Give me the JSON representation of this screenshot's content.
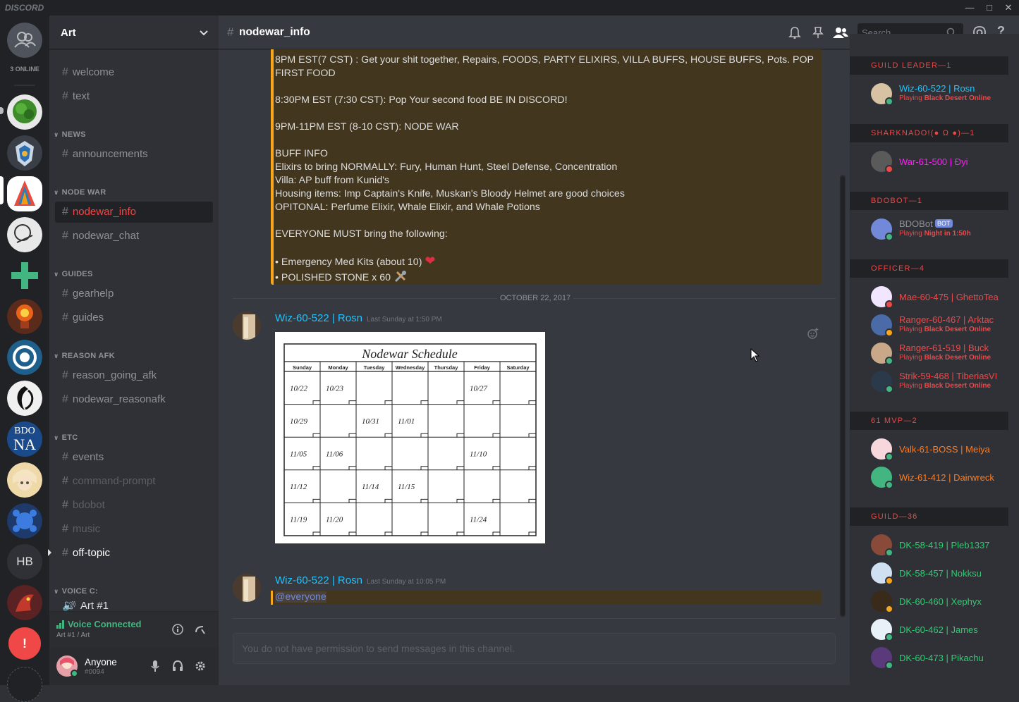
{
  "app": {
    "logo": "DISCORD",
    "win_min": "—",
    "win_max": "□",
    "win_close": "✕"
  },
  "guilds": {
    "online_count": "3 ONLINE",
    "hb_label": "HB",
    "bdo_na_label_1": "BDO",
    "bdo_na_label_2": "NA",
    "alert": "!"
  },
  "sidebar": {
    "guild_name": "Art",
    "channels_top": [
      {
        "name": "welcome"
      },
      {
        "name": "text"
      }
    ],
    "categories": [
      {
        "name": "NEWS",
        "channels": [
          "announcements"
        ]
      },
      {
        "name": "NODE WAR",
        "channels": [
          "nodewar_info",
          "nodewar_chat"
        ]
      },
      {
        "name": "GUIDES",
        "channels": [
          "gearhelp",
          "guides"
        ]
      },
      {
        "name": "REASON AFK",
        "channels": [
          "reason_going_afk",
          "nodewar_reasonafk"
        ]
      },
      {
        "name": "ETC",
        "channels": [
          "events",
          "command-prompt",
          "bdobot",
          "music",
          "off-topic"
        ]
      },
      {
        "name": "VOICE C:",
        "channels": [
          "Art #1"
        ]
      }
    ],
    "voice": {
      "status": "Voice Connected",
      "location": "Art #1 / Art"
    },
    "user": {
      "name": "Anyone",
      "tag": "#0094"
    }
  },
  "channel": {
    "name": "nodewar_info",
    "search_placeholder": "Search",
    "no_permission": "You do not have permission to send messages in this channel."
  },
  "messages": {
    "embed_lines": [
      "8PM EST(7 CST) : Get your shit together, Repairs, FOODS, PARTY ELIXIRS, VILLA BUFFS, HOUSE BUFFS, Pots. POP FIRST FOOD",
      "8:30PM EST (7:30 CST): Pop Your second food BE IN DISCORD!",
      "9PM-11PM EST (8-10 CST): NODE WAR",
      "BUFF INFO",
      "Elixirs to bring NORMALLY: Fury, Human Hunt, Steel Defense, Concentration",
      "Villa: AP buff from Kunid's",
      "Housing items: Imp Captain's Knife, Muskan's Bloody Helmet are good choices",
      "OPITONAL: Perfume Elixir, Whale Elixir, and Whale Potions",
      "EVERYONE MUST bring the following:",
      "• Emergency Med Kits (about 10)",
      "• POLISHED STONE x 60"
    ],
    "date_divider": "OCTOBER 22, 2017",
    "msg1": {
      "author": "Wiz-60-522 | Rosn",
      "timestamp": "Last Sunday at 1:50 PM"
    },
    "msg2": {
      "author": "Wiz-60-522 | Rosn",
      "timestamp": "Last Sunday at 10:05 PM",
      "text": "@everyone"
    },
    "schedule": {
      "title": "Nodewar Schedule",
      "days": [
        "Sunday",
        "Monday",
        "Tuesday",
        "Wednesday",
        "Thursday",
        "Friday",
        "Saturday"
      ],
      "rows": [
        [
          "10/22",
          "10/23",
          "",
          "",
          "",
          "10/27",
          ""
        ],
        [
          "10/29",
          "",
          "10/31",
          "11/01",
          "",
          "",
          ""
        ],
        [
          "11/05",
          "11/06",
          "",
          "",
          "",
          "11/10",
          ""
        ],
        [
          "11/12",
          "",
          "11/14",
          "11/15",
          "",
          "",
          ""
        ],
        [
          "11/19",
          "11/20",
          "",
          "",
          "",
          "11/24",
          ""
        ]
      ]
    }
  },
  "members": {
    "groups": [
      {
        "name": "GUILD LEADER—1",
        "members": [
          {
            "name": "Wiz-60-522 | Rosn",
            "color": "#1ec4ff",
            "playing": "Playing ",
            "game": "Black Desert Online",
            "status": "#43b581"
          }
        ]
      },
      {
        "name": "SHARKNADO!(● Ω ●)—1",
        "members": [
          {
            "name": "War-61-500 | Đyi",
            "color": "#ff1ef7",
            "playing": "",
            "game": "",
            "status": "#f04747"
          }
        ]
      },
      {
        "name": "BDOBOT—1",
        "members": [
          {
            "name": "BDOBot",
            "color": "#8e9297",
            "badge": "BOT",
            "playing": "Playing ",
            "game": "Night in 1:50h",
            "status": "#43b581"
          }
        ]
      },
      {
        "name": "OFFICER—4",
        "members": [
          {
            "name": "Mae-60-475 | GhettoTea",
            "color": "#f04747",
            "playing": "",
            "game": "",
            "status": "#f04747"
          },
          {
            "name": "Ranger-60-467 | Arktac",
            "color": "#f04747",
            "playing": "Playing ",
            "game": "Black Desert Online",
            "status": "#faa61a"
          },
          {
            "name": "Ranger-61-519 | Buck",
            "color": "#f04747",
            "playing": "Playing ",
            "game": "Black Desert Online",
            "status": "#43b581"
          },
          {
            "name": "Strik-59-468 | TiberiasVI",
            "color": "#f04747",
            "playing": "Playing ",
            "game": "Black Desert Online",
            "status": "#43b581"
          }
        ]
      },
      {
        "name": "61 MVP—2",
        "members": [
          {
            "name": "Valk-61-BOSS | Meiya",
            "color": "#ff7b1e",
            "playing": "",
            "game": "",
            "status": "#43b581"
          },
          {
            "name": "Wiz-61-412 | Dairwreck",
            "color": "#ff7b1e",
            "playing": "",
            "game": "",
            "status": "#43b581"
          }
        ]
      },
      {
        "name": "GUILD—36",
        "members": [
          {
            "name": "DK-58-419 | Pleb1337",
            "color": "#2ecc71",
            "playing": "",
            "game": "",
            "status": "#43b581"
          },
          {
            "name": "DK-58-457 | Nokksu",
            "color": "#2ecc71",
            "playing": "",
            "game": "",
            "status": "#faa61a"
          },
          {
            "name": "DK-60-460 | Xephyx",
            "color": "#2ecc71",
            "playing": "",
            "game": "",
            "status": "#faa61a"
          },
          {
            "name": "DK-60-462 | James",
            "color": "#2ecc71",
            "playing": "",
            "game": "",
            "status": "#43b581"
          },
          {
            "name": "DK-60-473 | Pikachu",
            "color": "#2ecc71",
            "playing": "",
            "game": "",
            "status": "#43b581"
          }
        ]
      }
    ]
  }
}
